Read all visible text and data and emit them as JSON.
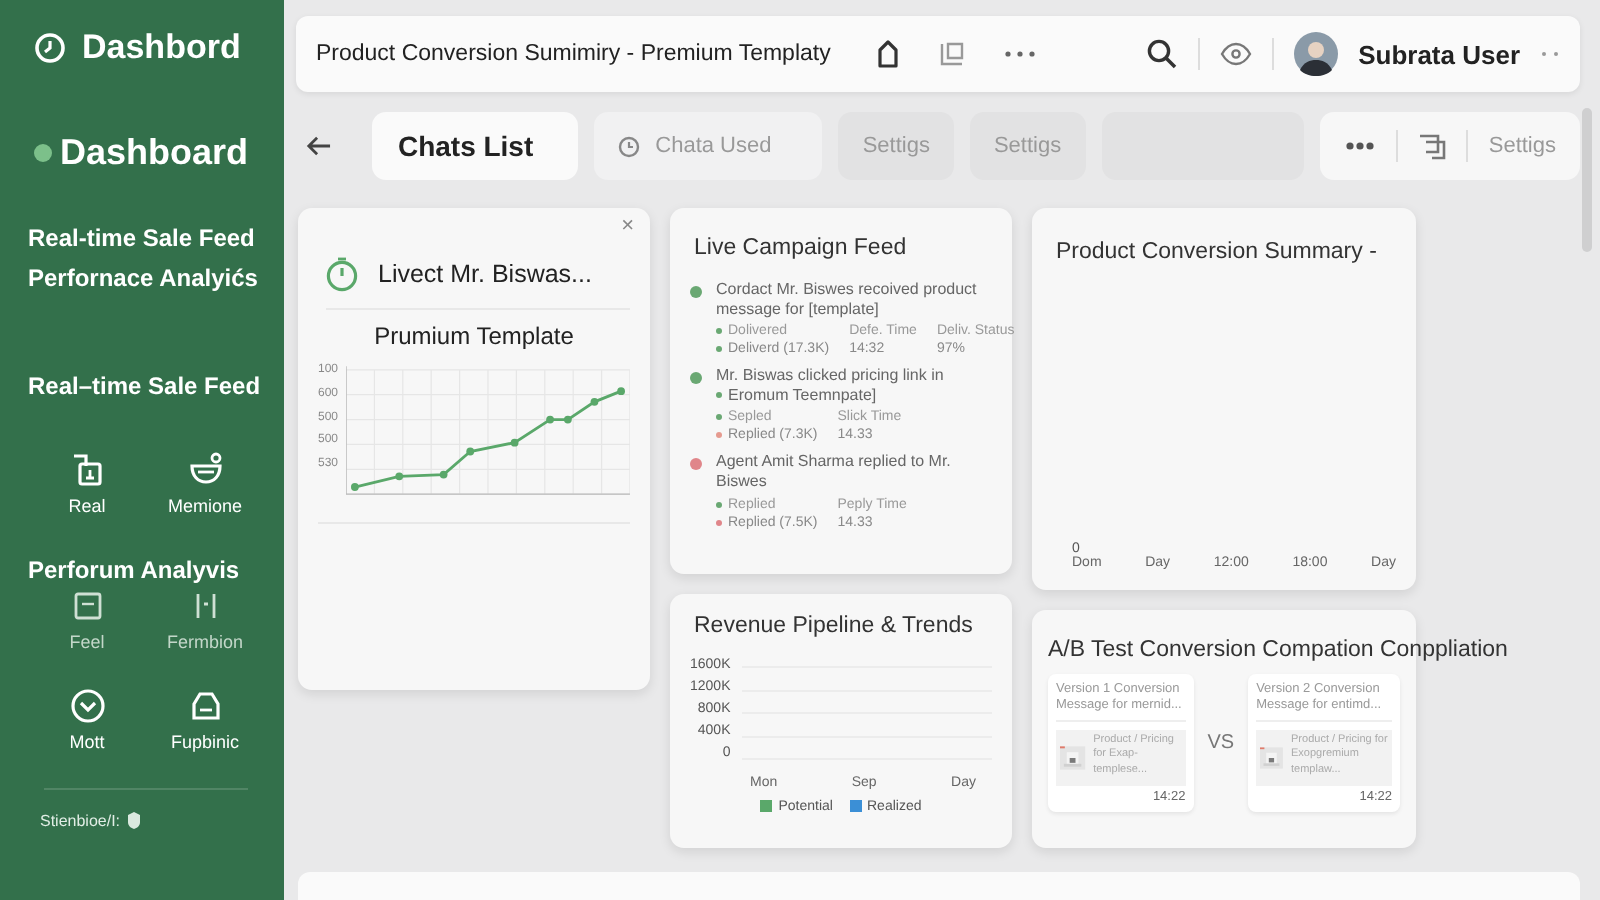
{
  "sidebar": {
    "title": "Dashbord",
    "items": [
      {
        "label": "Dashboard",
        "selected": true
      },
      {
        "label": "Real-time Sale Feed",
        "selected": false
      },
      {
        "label": "Perfornace Analyićs",
        "selected": false
      },
      {
        "label": "Real–time Sale Feed",
        "selected": false
      }
    ],
    "groups": [
      {
        "tiles": [
          "Real",
          "Memione"
        ]
      },
      {
        "heading": "Perforum Analyvis",
        "tiles": [
          "Feel",
          "Fermbion"
        ]
      },
      {
        "tiles": [
          "Mott",
          "Fupbinic"
        ]
      }
    ],
    "footer": "Stienbioe/I:"
  },
  "topbar": {
    "title": "Product Conversion Sumimiry - Premium Templaty",
    "user": "Subrata User"
  },
  "toolbar": {
    "tabs": [
      {
        "label": "Chats List",
        "selected": true
      },
      {
        "label": "Chata Used",
        "selected": false
      },
      {
        "label": "Settigs",
        "selected": false
      },
      {
        "label": "Settigs",
        "selected": false
      }
    ],
    "right_label": "Settigs"
  },
  "chat_card": {
    "title": "Livect Mr. Biswas...",
    "subtitle": "Prumium Template",
    "y_labels": [
      "100",
      "600",
      "500",
      "500",
      "530"
    ],
    "close": "×"
  },
  "campaign_feed": {
    "title": "Live Campaign Feed",
    "entries": [
      {
        "color": "#6aa873",
        "text": "Cordact Mr. Biswes recoived product message for [template]",
        "status": [
          {
            "text": "Dolivered",
            "color": "#6aa873"
          },
          {
            "text": "Deliverd (17.3K)",
            "color": "#6aa873"
          }
        ],
        "details": [
          {
            "header": "Defe. Time",
            "value": "14:32"
          },
          {
            "header": "Deliv. Status",
            "value": "97%"
          }
        ]
      },
      {
        "color": "#6aa873",
        "text": "Mr. Biswas clicked pricing link in",
        "extra": "Eromum Teemnpate]",
        "status": [
          {
            "text": "Sepled",
            "color": "#6aa873"
          },
          {
            "text": "Replied (7.3K)",
            "color": "#e59a8f"
          }
        ],
        "details": [
          {
            "header": "Slick Time",
            "value": "14.33"
          }
        ]
      },
      {
        "color": "#e0868a",
        "text": "Agent Amit Sharma replied to Mr. Biswes",
        "status": [
          {
            "text": "Replied",
            "color": "#6aa873"
          },
          {
            "text": "Replied (7.5K)",
            "color": "#e0868a"
          }
        ],
        "details": [
          {
            "header": "Peply Time",
            "value": "14.33"
          }
        ]
      }
    ]
  },
  "revenue": {
    "title": "Revenue Pipeline & Trends",
    "y_labels": [
      "1600K",
      "1200K",
      "800K",
      "400K",
      "0"
    ],
    "x_labels": [
      "Mon",
      "Sep",
      "Day"
    ],
    "legend": [
      {
        "label": "Potential",
        "color": "#5aa86a"
      },
      {
        "label": "Realized",
        "color": "#3b8fd6"
      }
    ]
  },
  "conversion_summary": {
    "title": "Product Conversion Summary -",
    "y_labels": [
      "0"
    ],
    "x_labels": [
      "Dom",
      "Day",
      "12:00",
      "18:00",
      "Day"
    ]
  },
  "ab_test": {
    "title": "A/B Test Conversion Compation Conppliation",
    "vs": "VS",
    "versions": [
      {
        "title": "Version 1 Conversion Message for mernid...",
        "text": "Product / Pricing for Exap-templese...",
        "time": "14:22"
      },
      {
        "title": "Version 2 Conversion Message for entimd...",
        "text": "Product / Pricing for Exopgremium templaw...",
        "time": "14:22"
      }
    ]
  }
}
